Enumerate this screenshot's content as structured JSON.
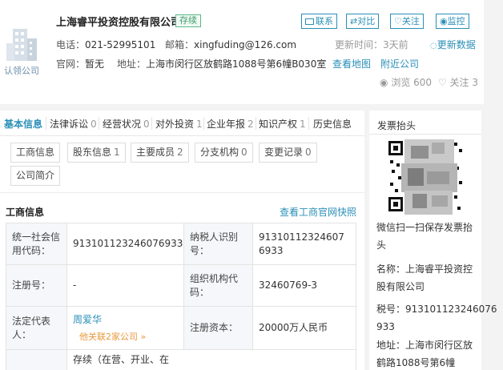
{
  "company": {
    "name": "上海睿平投资控股有限公司",
    "status": "存续",
    "logo_caption": "认领公司"
  },
  "actions": [
    "联系",
    "对比",
    "关注",
    "监控"
  ],
  "contact": {
    "phone_label": "电话：",
    "phone": "021-52995101",
    "email_label": "邮箱：",
    "email": "xingfuding@126.com",
    "update_label": "更新时间：",
    "update_value": "3天前",
    "update_link": "更新数据",
    "site_label": "官网：",
    "site": "暂无",
    "addr_label": "地址：",
    "addr": "上海市闵行区放鹤路1088号第6幢B030室",
    "map_link": "查看地图",
    "nearby_link": "附近公司",
    "views_label": "浏览",
    "views": "600",
    "follow_label": "关注",
    "follows": "3"
  },
  "tabs": [
    {
      "label": "基本信息",
      "count": ""
    },
    {
      "label": "法律诉讼",
      "count": "0"
    },
    {
      "label": "经营状况",
      "count": "0"
    },
    {
      "label": "对外投资",
      "count": "1"
    },
    {
      "label": "企业年报",
      "count": "2"
    },
    {
      "label": "知识产权",
      "count": "1"
    },
    {
      "label": "历史信息",
      "count": ""
    }
  ],
  "chips": [
    {
      "label": "工商信息",
      "count": ""
    },
    {
      "label": "股东信息",
      "count": "1"
    },
    {
      "label": "主要成员",
      "count": "2"
    },
    {
      "label": "分支机构",
      "count": "0"
    },
    {
      "label": "变更记录",
      "count": "0"
    },
    {
      "label": "公司简介",
      "count": ""
    }
  ],
  "section": {
    "title": "工商信息",
    "link": "查看工商官网快照"
  },
  "table": {
    "credit_code_label": "统一社会信用代码：",
    "credit_code": "913101123246076933",
    "tax_id_label": "纳税人识别号：",
    "tax_id": "913101123246076933",
    "reg_no_label": "注册号：",
    "reg_no": "-",
    "org_code_label": "组织机构代码：",
    "org_code": "32460769-3",
    "legal_rep_label": "法定代表人：",
    "legal_rep": "周爱华",
    "legal_rep_related": "他关联2家公司 »",
    "capital_label": "注册资本：",
    "capital": "20000万人民币",
    "status_partial": "存续（在营、开业、在"
  },
  "invoice": {
    "title": "发票抬头",
    "scan_text": "微信扫一扫保存发票抬头",
    "name_label": "名称：",
    "name": "上海睿平投资控股有限公司",
    "tax_label": "税号：",
    "tax": "913101123246076933",
    "addr_label": "地址：",
    "addr": "上海市闵行区放鹤路1088号第6幢"
  },
  "colors": {
    "accent": "#2a8fb7",
    "status_green": "#3f9a6b",
    "orange": "#e8993c"
  }
}
